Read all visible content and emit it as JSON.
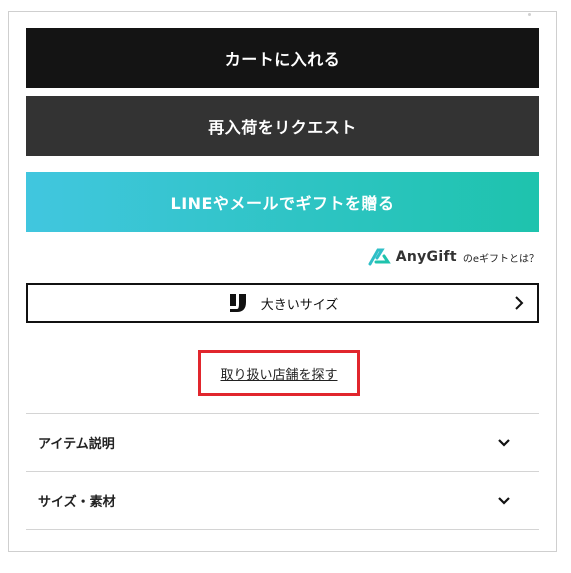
{
  "buttons": {
    "add_to_cart": "カートに入れる",
    "restock_request": "再入荷をリクエスト",
    "gift": "LINEやメールでギフトを贈る"
  },
  "anygift": {
    "brand": "AnyGift",
    "question": "のeギフトとは？"
  },
  "size_option": {
    "label": "大きいサイズ",
    "icon": "brand-logo-icon"
  },
  "store_link": "取り扱い店舗を探す",
  "accordions": [
    {
      "label": "アイテム説明"
    },
    {
      "label": "サイズ・素材"
    }
  ],
  "colors": {
    "cart_button": "#141414",
    "restock_button": "#333333",
    "gift_gradient_start": "#41c6df",
    "gift_gradient_end": "#1ec3ad",
    "highlight_border": "#e1262d"
  }
}
